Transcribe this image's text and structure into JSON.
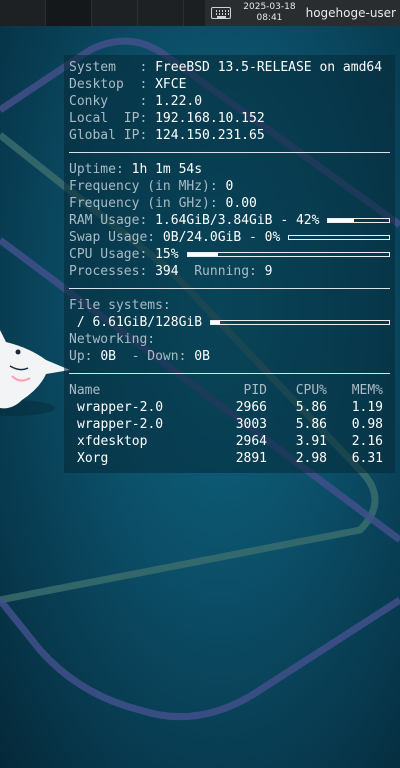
{
  "panel": {
    "date": "2025-03-18",
    "time": "08:41",
    "user": "hogehoge-user",
    "keyboard_icon": "keyboard-icon"
  },
  "conky": {
    "system_label": "System   : ",
    "system_value": "FreeBSD 13.5-RELEASE on amd64",
    "desktop_label": "Desktop  : ",
    "desktop_value": "XFCE",
    "conky_label": "Conky    : ",
    "conky_value": "1.22.0",
    "local_ip_label": "Local  IP: ",
    "local_ip_value": "192.168.10.152",
    "global_ip_label": "Global IP: ",
    "global_ip_value": "124.150.231.65",
    "uptime_label": "Uptime: ",
    "uptime_value": "1h 1m 54s",
    "freq_mhz_label": "Frequency (in MHz): ",
    "freq_mhz_value": "0",
    "freq_ghz_label": "Frequency (in GHz): ",
    "freq_ghz_value": "0.00",
    "ram_label": "RAM Usage: ",
    "ram_value": "1.64GiB/3.84GiB - 42%",
    "ram_fraction": 0.42,
    "swap_label": "Swap Usage: ",
    "swap_value": "0B/24.0GiB - 0%",
    "swap_fraction": 0.0,
    "cpu_label": "CPU Usage: ",
    "cpu_value": "15%",
    "cpu_fraction": 0.15,
    "processes_label": "Processes: ",
    "processes_value": "394",
    "running_label": "  Running: ",
    "running_value": "9",
    "fs_label": "File systems:",
    "fs_root_label": " / ",
    "fs_root_value": "6.61GiB/128GiB",
    "fs_fraction": 0.05,
    "net_label": "Networking:",
    "up_label": "Up: ",
    "up_value": "0B",
    "down_label": "  - Down: ",
    "down_value": "0B",
    "table": {
      "headers": [
        "Name",
        "PID",
        "CPU%",
        "MEM%"
      ],
      "rows": [
        [
          "wrapper-2.0",
          "2966",
          "5.86",
          "1.19"
        ],
        [
          "wrapper-2.0",
          "3003",
          "5.86",
          "0.98"
        ],
        [
          "xfdesktop",
          "2964",
          "3.91",
          "2.16"
        ],
        [
          "Xorg",
          "2891",
          "2.98",
          "6.31"
        ]
      ]
    }
  }
}
